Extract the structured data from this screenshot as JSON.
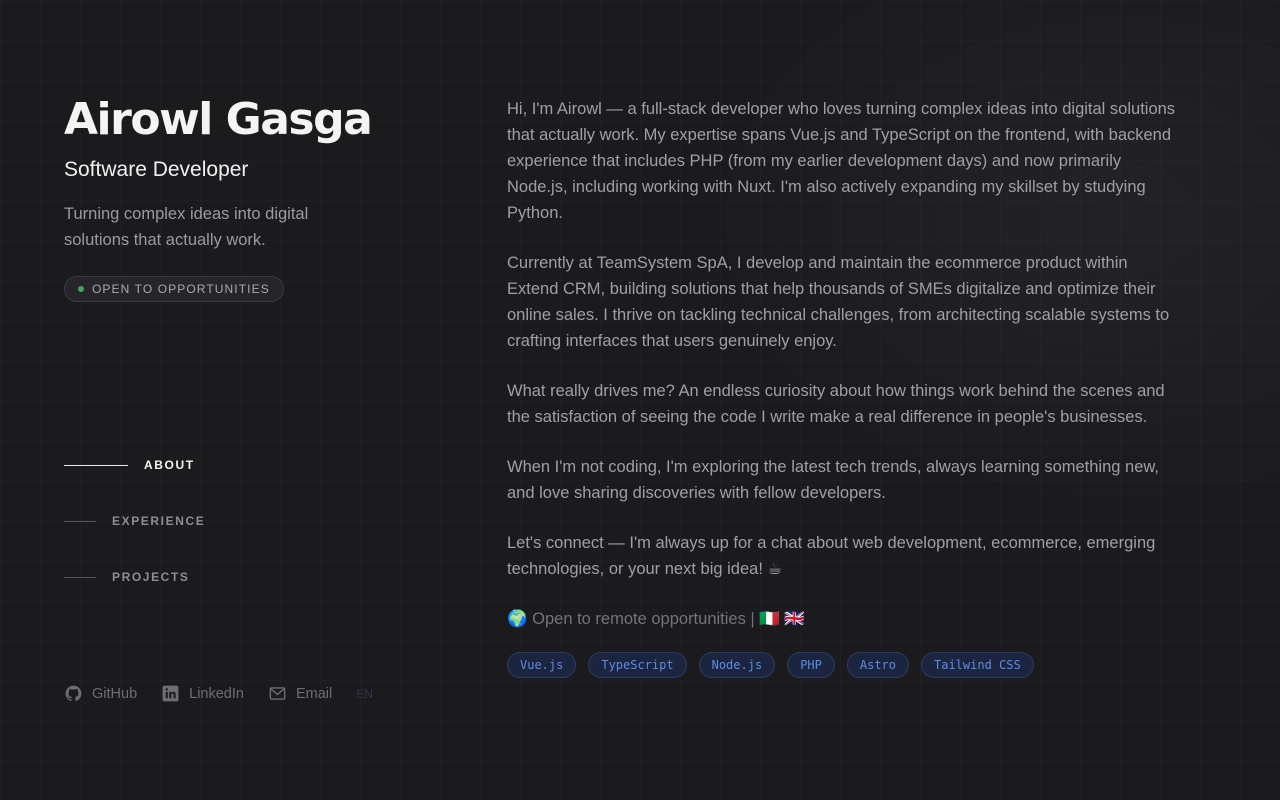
{
  "profile": {
    "name": "Airowl Gasga",
    "role": "Software Developer",
    "tagline": "Turning complex ideas into digital solutions that actually work.",
    "badge": "OPEN TO OPPORTUNITIES"
  },
  "nav": {
    "items": [
      {
        "label": "ABOUT",
        "active": true
      },
      {
        "label": "EXPERIENCE",
        "active": false
      },
      {
        "label": "PROJECTS",
        "active": false
      }
    ]
  },
  "social": {
    "github": "GitHub",
    "linkedin": "LinkedIn",
    "email": "Email",
    "lang": "EN"
  },
  "about": {
    "paragraphs": [
      "Hi, I'm Airowl — a full-stack developer who loves turning complex ideas into digital solutions that actually work. My expertise spans Vue.js and TypeScript on the frontend, with backend experience that includes PHP (from my earlier development days) and now primarily Node.js, including working with Nuxt. I'm also actively expanding my skillset by studying Python.",
      "Currently at TeamSystem SpA, I develop and maintain the ecommerce product within Extend CRM, building solutions that help thousands of SMEs digitalize and optimize their online sales. I thrive on tackling technical challenges, from architecting scalable systems to crafting interfaces that users genuinely enjoy.",
      "What really drives me? An endless curiosity about how things work behind the scenes and the satisfaction of seeing the code I write make a real difference in people's businesses.",
      "When I'm not coding, I'm exploring the latest tech trends, always learning something new, and love sharing discoveries with fellow developers.",
      "Let's connect — I'm always up for a chat about web development, ecommerce, emerging technologies, or your next big idea! ☕"
    ],
    "remote": "🌍 Open to remote opportunities | 🇮🇹 🇬🇧",
    "tags": [
      "Vue.js",
      "TypeScript",
      "Node.js",
      "PHP",
      "Astro",
      "Tailwind CSS"
    ]
  },
  "colors": {
    "background": "#1b1b1e",
    "status_dot": "#3fa55f",
    "tag_text": "#5d8ce0"
  }
}
